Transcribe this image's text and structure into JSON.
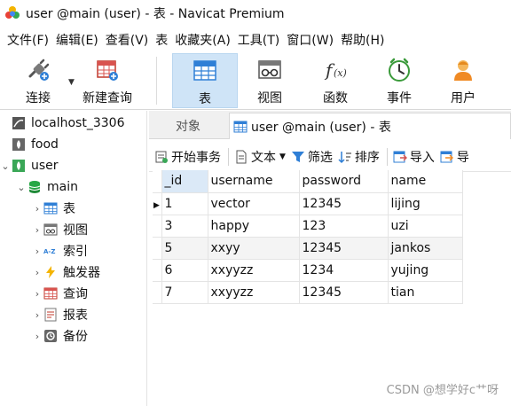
{
  "window": {
    "title": "user @main (user) - 表 - Navicat Premium",
    "logo_icon": "navicat-logo-icon"
  },
  "menubar": [
    "文件(F)",
    "编辑(E)",
    "查看(V)",
    "表",
    "收藏夹(A)",
    "工具(T)",
    "窗口(W)",
    "帮助(H)"
  ],
  "toolbar": {
    "connect": {
      "label": "连接",
      "icon": "plug-icon"
    },
    "new_query": {
      "label": "新建查询",
      "icon": "new-query-icon"
    },
    "table": {
      "label": "表",
      "icon": "table-icon",
      "active": true
    },
    "view": {
      "label": "视图",
      "icon": "view-icon"
    },
    "function": {
      "label": "函数",
      "icon": "function-icon"
    },
    "event": {
      "label": "事件",
      "icon": "clock-icon"
    },
    "user": {
      "label": "用户",
      "icon": "user-icon"
    }
  },
  "tree": {
    "connections": [
      {
        "label": "localhost_3306",
        "icon": "mysql-icon",
        "expanded": false
      },
      {
        "label": "food",
        "icon": "mongo-leaf-icon",
        "expanded": false
      },
      {
        "label": "user",
        "icon": "mongo-leaf-icon",
        "expanded": true
      }
    ],
    "database": {
      "label": "main",
      "icon": "database-icon"
    },
    "items": [
      {
        "label": "表",
        "icon": "table-icon"
      },
      {
        "label": "视图",
        "icon": "view-icon"
      },
      {
        "label": "索引",
        "icon": "index-icon"
      },
      {
        "label": "触发器",
        "icon": "trigger-icon"
      },
      {
        "label": "查询",
        "icon": "query-icon"
      },
      {
        "label": "报表",
        "icon": "report-icon"
      },
      {
        "label": "备份",
        "icon": "backup-icon"
      }
    ]
  },
  "tabs": {
    "objects": "对象",
    "active": "user @main (user) - 表"
  },
  "subtoolbar": {
    "begin_transaction": "开始事务",
    "text": "文本",
    "filter": "筛选",
    "sort": "排序",
    "import": "导入",
    "export": "导"
  },
  "grid": {
    "columns": [
      "_id",
      "username",
      "password",
      "name"
    ],
    "rows": [
      [
        "1",
        "vector",
        "12345",
        "lijing"
      ],
      [
        "3",
        "happy",
        "123",
        "uzi"
      ],
      [
        "5",
        "xxyy",
        "12345",
        "jankos"
      ],
      [
        "6",
        "xxyyzz",
        "1234",
        "yujing"
      ],
      [
        "7",
        "xxyyzz",
        "12345",
        "tian"
      ]
    ],
    "current_row": 0
  },
  "watermark": "CSDN @想学好c艹呀",
  "colors": {
    "active_toolbar_bg": "#cfe4f7",
    "sorted_header_bg": "#dbe9f7",
    "alt_row_bg": "#f4f4f4"
  }
}
